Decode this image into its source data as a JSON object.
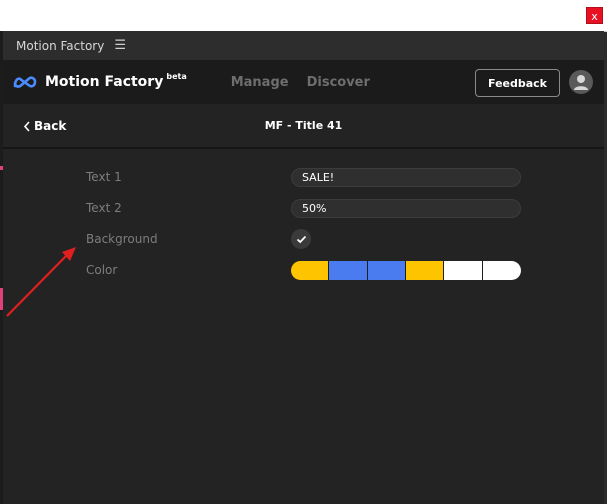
{
  "window": {
    "close_label": "x"
  },
  "panel": {
    "title": "Motion Factory",
    "menu_icon": "hamburger-menu-icon"
  },
  "header": {
    "brand_name": "Motion Factory",
    "brand_badge": "beta",
    "logo_icon": "meta-infinity-logo-icon",
    "nav": [
      {
        "label": "Manage"
      },
      {
        "label": "Discover"
      }
    ],
    "feedback_label": "Feedback",
    "avatar_icon": "user-avatar-icon"
  },
  "subheader": {
    "back_label": "Back",
    "back_icon": "chevron-left-icon",
    "title": "MF - Title 41"
  },
  "fields": {
    "text1_label": "Text 1",
    "text1_value": "SALE!",
    "text2_label": "Text 2",
    "text2_value": "50%",
    "background_label": "Background",
    "background_checked": true,
    "check_icon": "checkmark-icon",
    "color_label": "Color",
    "color_swatches": [
      "#ffc400",
      "#4a7cf0",
      "#4a7cf0",
      "#ffc400",
      "#ffffff",
      "#ffffff"
    ]
  },
  "annotation": {
    "arrow_color": "#e01f1f"
  }
}
